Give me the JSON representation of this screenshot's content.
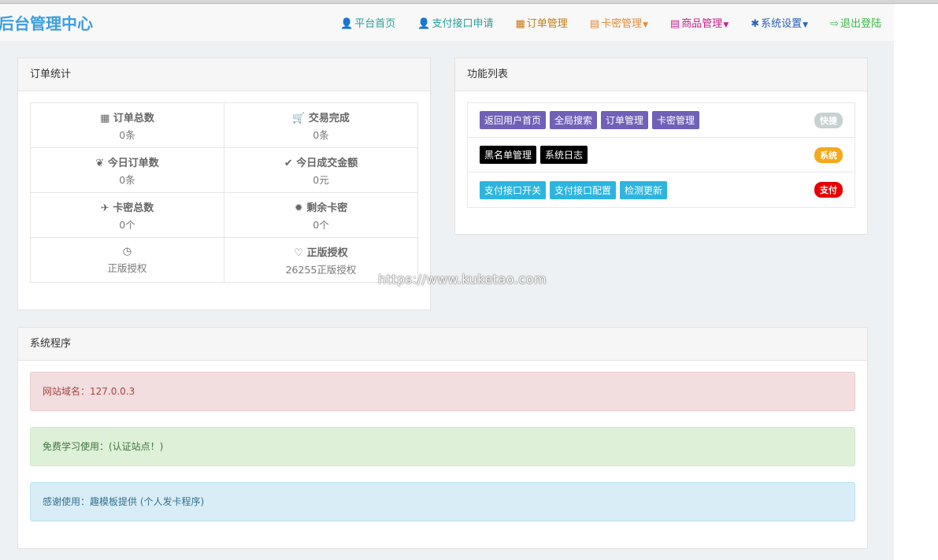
{
  "brand": "后台管理中心",
  "nav": [
    {
      "label": "平台首页",
      "icon": "user-icon",
      "color": "#2a9d9d"
    },
    {
      "label": "支付接口申请",
      "icon": "user-icon",
      "color": "#2a9d9d"
    },
    {
      "label": "订单管理",
      "icon": "calendar-icon",
      "color": "#c67a15"
    },
    {
      "label": "卡密管理",
      "icon": "list-icon",
      "color": "#e58a3c",
      "caret": true
    },
    {
      "label": "商品管理",
      "icon": "list-icon",
      "color": "#cc1e8a",
      "caret": true
    },
    {
      "label": "系统设置",
      "icon": "gear-icon",
      "color": "#2a62b8",
      "caret": true
    },
    {
      "label": "退出登陆",
      "icon": "logout-icon",
      "color": "#3cb84a"
    }
  ],
  "order_stats": {
    "title": "订单统计",
    "cells": [
      {
        "icon": "grid-icon",
        "glyph": "▦",
        "label": "订单总数",
        "value": "0条"
      },
      {
        "icon": "cart-icon",
        "glyph": "🛒",
        "label": "交易完成",
        "value": "0条"
      },
      {
        "icon": "leaf-icon",
        "glyph": "❦",
        "label": "今日订单数",
        "value": "0条"
      },
      {
        "icon": "check-icon",
        "glyph": "✔",
        "label": "今日成交金额",
        "value": "0元"
      },
      {
        "icon": "plane-icon",
        "glyph": "✈",
        "label": "卡密总数",
        "value": "0个"
      },
      {
        "icon": "certificate-icon",
        "glyph": "✹",
        "label": "剩余卡密",
        "value": "0个"
      },
      {
        "icon": "dashboard-icon",
        "glyph": "◷",
        "label": "",
        "value": "正版授权"
      },
      {
        "icon": "heart-icon",
        "glyph": "♡",
        "label": "正版授权",
        "value": "26255正版授权"
      }
    ]
  },
  "functions": {
    "title": "功能列表",
    "rows": [
      {
        "tags": [
          "返回用户首页",
          "全局搜索",
          "订单管理",
          "卡密管理"
        ],
        "tag_color": "#7160b8",
        "badge": "快捷",
        "badge_color": "#c8d0d2"
      },
      {
        "tags": [
          "黑名单管理",
          "系统日志"
        ],
        "tag_color": "#000000",
        "badge": "系统",
        "badge_color": "#f4a81b"
      },
      {
        "tags": [
          "支付接口开关",
          "支付接口配置",
          "检测更新"
        ],
        "tag_color": "#2bb5e0",
        "badge": "支付",
        "badge_color": "#e60000"
      }
    ]
  },
  "system": {
    "title": "系统程序",
    "alerts": [
      {
        "text": "网站域名：127.0.0.3"
      },
      {
        "text": "免费学习使用：(认证站点！)"
      },
      {
        "text": "感谢使用：趣模板提供 (个人发卡程序)"
      }
    ]
  },
  "watermark": "https://www.kuketao.com"
}
